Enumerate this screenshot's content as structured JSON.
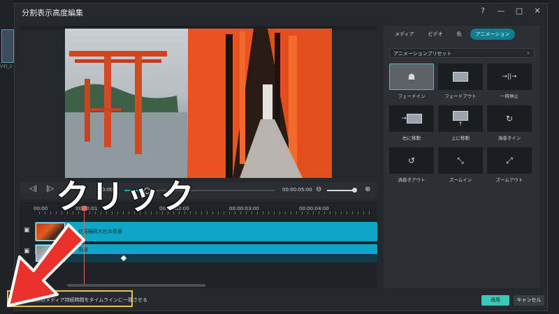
{
  "background": {
    "left_clip_label": "VID_2"
  },
  "dialog": {
    "title": "分割表示高度編集",
    "help_icon": "help-icon",
    "window_buttons": [
      "minimize-icon",
      "maximize-icon",
      "close-icon"
    ]
  },
  "transport": {
    "current_time": "0:00",
    "total_time": "00:00:05:00"
  },
  "timeline": {
    "ruler": [
      "00:00",
      "00:00:01",
      "00:00:02:00",
      "00:00:03:00",
      "00:00:04:00"
    ],
    "tracks": [
      {
        "label": "伏見稲荷大社の鳥居"
      },
      {
        "label": "鳥居"
      }
    ]
  },
  "right_panel": {
    "tabs": [
      {
        "label": "メディア",
        "active": false
      },
      {
        "label": "ビデオ",
        "active": false
      },
      {
        "label": "色",
        "active": false
      },
      {
        "label": "アニメーション",
        "active": true
      }
    ],
    "preset_dropdown": "アニメーションプリセット",
    "animations": [
      {
        "label": "フェードイン",
        "selected": true
      },
      {
        "label": "フェードアウト",
        "selected": false
      },
      {
        "label": "一時停止",
        "selected": false
      },
      {
        "label": "右に移動",
        "selected": false
      },
      {
        "label": "上に移動",
        "selected": false
      },
      {
        "label": "渦巻きイン",
        "selected": false
      },
      {
        "label": "渦巻きアウト",
        "selected": false
      },
      {
        "label": "ズームイン",
        "selected": false
      },
      {
        "label": "ズームアウト",
        "selected": false
      }
    ]
  },
  "footer": {
    "checkbox_label": "分割表示のメディア持続時間をタイムラインに一致させる",
    "checkbox_checked": true,
    "apply_label": "適用",
    "cancel_label": "キャンセル"
  },
  "annotation": {
    "text": "クリック"
  },
  "colors": {
    "accent": "#18b3a0",
    "clip": "#0fa5c7",
    "highlight": "#e3c44a",
    "arrow": "#e8322b"
  }
}
